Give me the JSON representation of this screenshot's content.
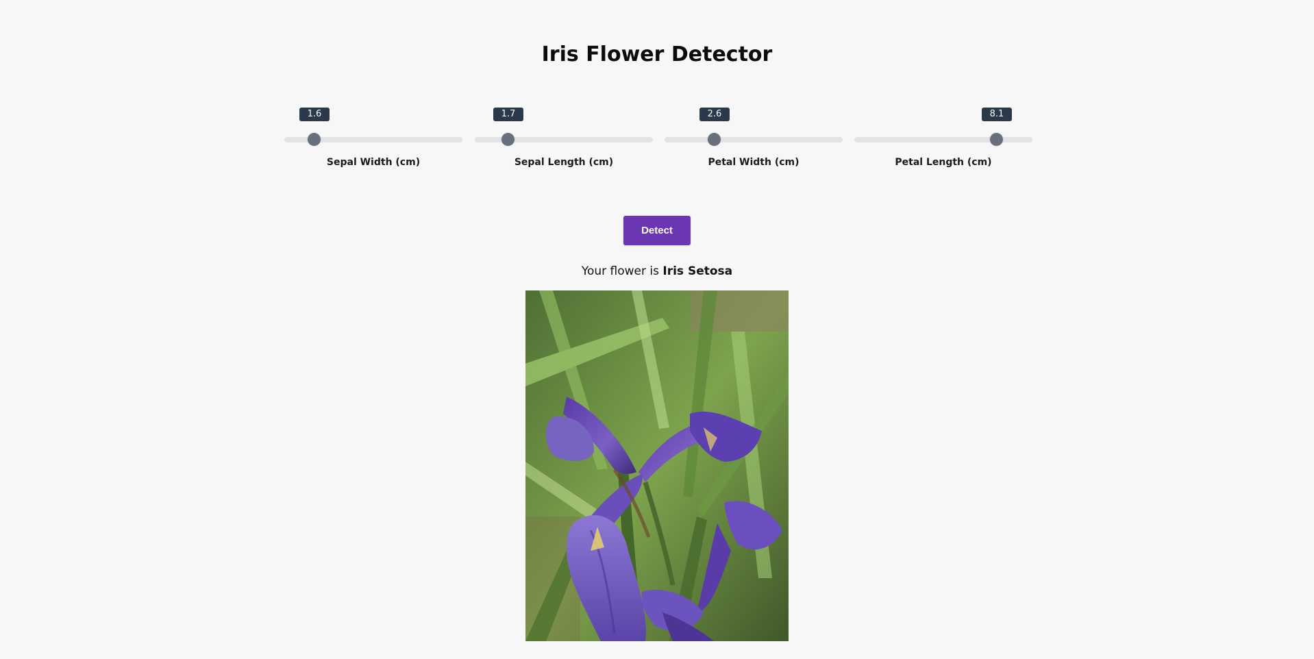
{
  "app": {
    "title": "Iris Flower Detector"
  },
  "sliders": [
    {
      "label": "Sepal Width (cm)",
      "value": "1.6",
      "fraction": 0.17
    },
    {
      "label": "Sepal Length (cm)",
      "value": "1.7",
      "fraction": 0.19
    },
    {
      "label": "Petal Width (cm)",
      "value": "2.6",
      "fraction": 0.28
    },
    {
      "label": "Petal Length (cm)",
      "value": "8.1",
      "fraction": 0.8
    }
  ],
  "actions": {
    "detect_label": "Detect"
  },
  "result": {
    "prefix": "Your flower is",
    "species": "Iris Setosa"
  },
  "colors": {
    "background": "#f7f7f7",
    "button": "#6a36b1",
    "value_bubble": "#2b3a4b",
    "slider_thumb": "#67707c",
    "slider_track": "#e2e3e6"
  }
}
